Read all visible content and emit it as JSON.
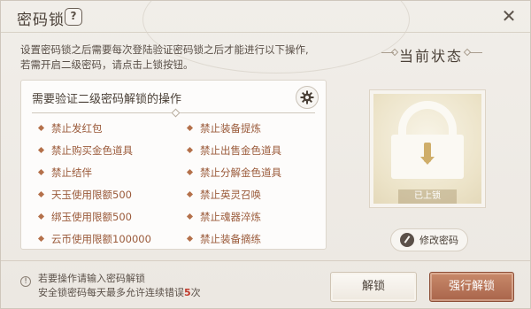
{
  "dialog": {
    "title": "密码锁",
    "help_icon": "question-icon",
    "close_icon": "close-icon"
  },
  "description": {
    "line1": "设置密码锁之后需要每次登陆验证密码锁之后才能进行以下操作,",
    "line2": "若需开启二级密码，请点击上锁按钮。"
  },
  "operations": {
    "title": "需要验证二级密码解锁的操作",
    "settings_icon": "gear-icon",
    "left": [
      "禁止发红包",
      "禁止购买金色道具",
      "禁止结伴",
      "天玉使用限额500",
      "绑玉使用限额500",
      "云币使用限额100000"
    ],
    "right": [
      "禁止装备提炼",
      "禁止出售金色道具",
      "禁止分解金色道具",
      "禁止英灵召唤",
      "禁止魂器淬炼",
      "禁止装备摘练"
    ]
  },
  "status": {
    "title": "当前状态",
    "lock_label": "已上锁",
    "lock_icon": "lock-icon",
    "change_password": "修改密码",
    "pen_icon": "pen-icon"
  },
  "footer": {
    "warn_icon": "info-icon",
    "line1": "若要操作请输入密码解锁",
    "line2_prefix": "安全锁密码每天最多允许连续错误",
    "line2_count": "5",
    "line2_suffix": "次",
    "unlock_button": "解锁",
    "force_unlock_button": "强行解锁"
  },
  "colors": {
    "accent": "#a9644a",
    "item_text": "#9a5a3a",
    "error_count": "#c0392b"
  }
}
